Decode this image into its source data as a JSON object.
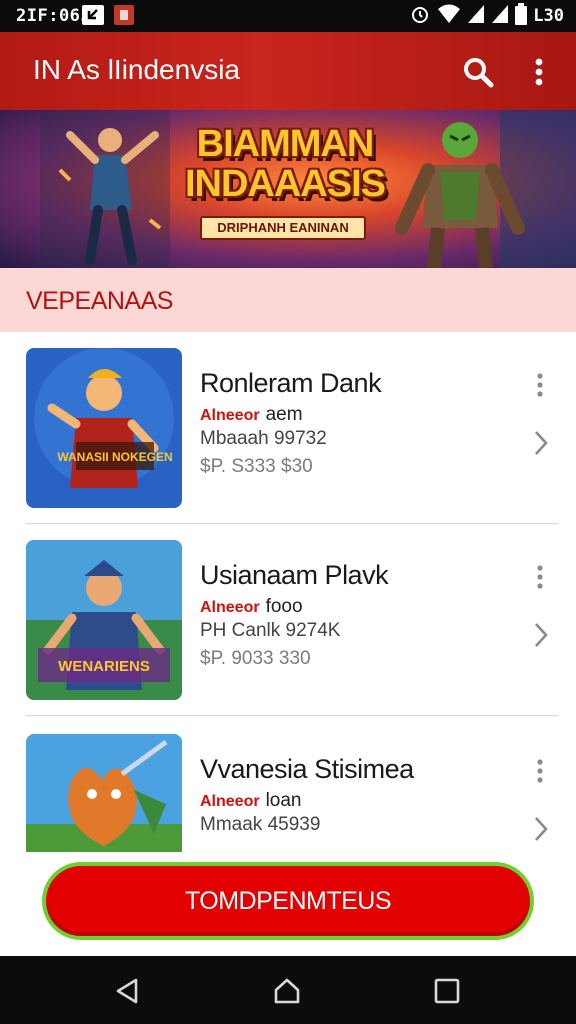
{
  "status_bar": {
    "time": "2IF:065",
    "right_text": "L30",
    "icons": [
      "nav-arrow-icon",
      "app-badge-icon",
      "alarm-icon",
      "wifi-icon",
      "signal-icon",
      "signal-icon",
      "battery-icon"
    ]
  },
  "app_bar": {
    "title": "IN   As lIindenvsia",
    "icons": [
      "search-icon",
      "more-vertical-icon"
    ]
  },
  "hero": {
    "title_line1": "BIAMMAN",
    "title_line2": "INDAAASIS",
    "ribbon": "DRIPHANH EANINAN"
  },
  "section": {
    "label": "VEPEANAAS"
  },
  "items": [
    {
      "name": "Ronleram Dank",
      "brand": "Alneeor",
      "brand_suffix": "aem",
      "meta": "Mbaaah 99732",
      "price": "$P. S333 $30",
      "thumb_text": "WANASII NOKEGEN"
    },
    {
      "name": "Usianaam Plavk",
      "brand": "Alneeor",
      "brand_suffix": "fooo",
      "meta": "PH Canlk 9274K",
      "price": "$P. 9033 330",
      "thumb_text": "WENARIENS"
    },
    {
      "name": "Vvanesia Stisimea",
      "brand": "Alneeor",
      "brand_suffix": "loan",
      "meta": "Mmaak 45939",
      "price": "",
      "thumb_text": ""
    }
  ],
  "cta": {
    "label": "TOMDPENMTEUS"
  },
  "nav_bar": {
    "icons": [
      "back-icon",
      "home-icon",
      "recents-icon"
    ]
  },
  "colors": {
    "app_bar": "#c0211a",
    "section_bg": "#fbd7d6",
    "accent_red": "#e30000",
    "cta_border": "#6fd12f"
  }
}
